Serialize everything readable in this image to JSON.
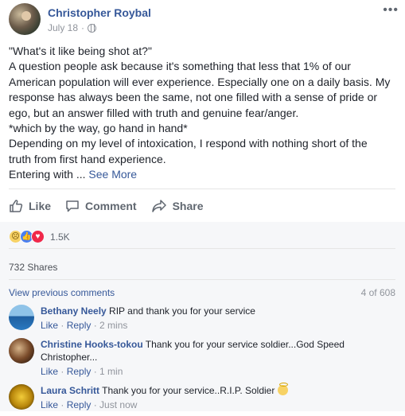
{
  "post": {
    "author": "Christopher Roybal",
    "date": "July 18",
    "date_separator": "·",
    "menu": "•••",
    "lines": [
      "\"What's it like being shot at?\"",
      "A question people ask because it's something that less that 1% of our American population will ever experience. Especially one on a daily basis. My response has always been the same, not one filled with a sense of pride or ego, but an answer filled with truth and genuine fear/anger.",
      "*which by the way, go hand in hand*",
      "Depending on my level of intoxication, I respond with nothing short of the truth from first hand experience."
    ],
    "truncated_line": "Entering with ...",
    "see_more": "See More"
  },
  "actions": {
    "like": "Like",
    "comment": "Comment",
    "share": "Share"
  },
  "reactions": {
    "count": "1.5K",
    "icons": [
      "sad-reaction",
      "like-reaction",
      "love-reaction"
    ],
    "shares": "732 Shares"
  },
  "comments_section": {
    "view_previous": "View previous comments",
    "count_label": "4 of 608",
    "items": [
      {
        "name": "Bethany Neely",
        "text": "RIP and thank you for your service",
        "like": "Like",
        "reply": "Reply",
        "time": "2 mins"
      },
      {
        "name": "Christine Hooks-tokou",
        "text": "Thank you for your service soldier...God Speed Christopher...",
        "like": "Like",
        "reply": "Reply",
        "time": "1 min"
      },
      {
        "name": "Laura Schritt",
        "text": "Thank you for your service..R.I.P. Soldier",
        "like": "Like",
        "reply": "Reply",
        "time": "Just now"
      }
    ]
  },
  "colors": {
    "link": "#365899",
    "muted": "#90949c",
    "text": "#1d2129",
    "footer_bg": "#f6f7f9"
  }
}
